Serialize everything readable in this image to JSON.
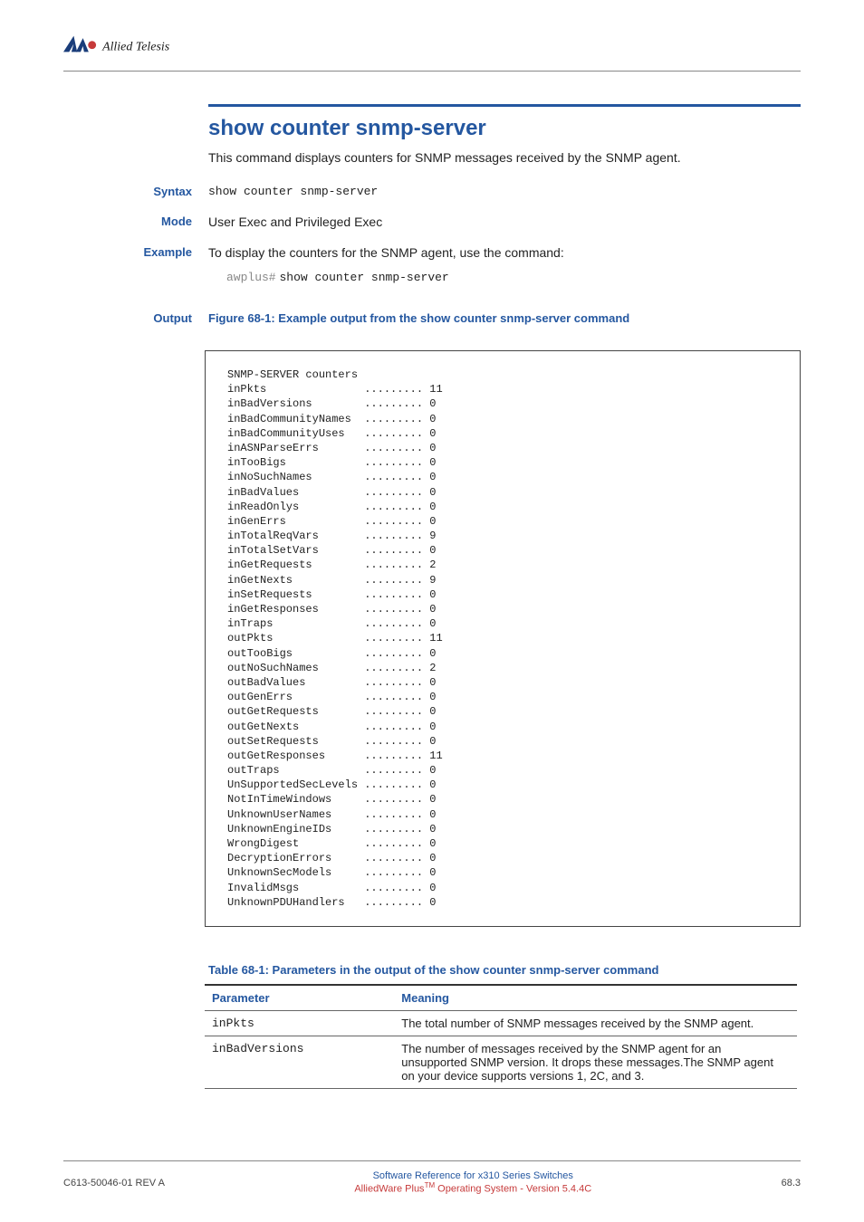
{
  "brand": "Allied Telesis",
  "title": "show counter snmp-server",
  "intro": "This command displays counters for SNMP messages received by the SNMP agent.",
  "sections": {
    "syntax": {
      "label": "Syntax",
      "text": "show counter snmp-server"
    },
    "mode": {
      "label": "Mode",
      "text": "User Exec and Privileged Exec"
    },
    "example": {
      "label": "Example",
      "text": "To display the counters for the SNMP agent, use the command:",
      "prompt": "awplus#",
      "cmd": "show counter snmp-server"
    },
    "output": {
      "label": "Output",
      "caption": "Figure 68-1: Example output from the show counter snmp-server command"
    }
  },
  "output_header": "SNMP-SERVER counters",
  "counters": [
    {
      "name": "inPkts",
      "value": "11"
    },
    {
      "name": "inBadVersions",
      "value": "0"
    },
    {
      "name": "inBadCommunityNames",
      "value": "0"
    },
    {
      "name": "inBadCommunityUses",
      "value": "0"
    },
    {
      "name": "inASNParseErrs",
      "value": "0"
    },
    {
      "name": "inTooBigs",
      "value": "0"
    },
    {
      "name": "inNoSuchNames",
      "value": "0"
    },
    {
      "name": "inBadValues",
      "value": "0"
    },
    {
      "name": "inReadOnlys",
      "value": "0"
    },
    {
      "name": "inGenErrs",
      "value": "0"
    },
    {
      "name": "inTotalReqVars",
      "value": "9"
    },
    {
      "name": "inTotalSetVars",
      "value": "0"
    },
    {
      "name": "inGetRequests",
      "value": "2"
    },
    {
      "name": "inGetNexts",
      "value": "9"
    },
    {
      "name": "inSetRequests",
      "value": "0"
    },
    {
      "name": "inGetResponses",
      "value": "0"
    },
    {
      "name": "inTraps",
      "value": "0"
    },
    {
      "name": "outPkts",
      "value": "11"
    },
    {
      "name": "outTooBigs",
      "value": "0"
    },
    {
      "name": "outNoSuchNames",
      "value": "2"
    },
    {
      "name": "outBadValues",
      "value": "0"
    },
    {
      "name": "outGenErrs",
      "value": "0"
    },
    {
      "name": "outGetRequests",
      "value": "0"
    },
    {
      "name": "outGetNexts",
      "value": "0"
    },
    {
      "name": "outSetRequests",
      "value": "0"
    },
    {
      "name": "outGetResponses",
      "value": "11"
    },
    {
      "name": "outTraps",
      "value": "0"
    },
    {
      "name": "UnSupportedSecLevels",
      "value": "0"
    },
    {
      "name": "NotInTimeWindows",
      "value": "0"
    },
    {
      "name": "UnknownUserNames",
      "value": "0"
    },
    {
      "name": "UnknownEngineIDs",
      "value": "0"
    },
    {
      "name": "WrongDigest",
      "value": "0"
    },
    {
      "name": "DecryptionErrors",
      "value": "0"
    },
    {
      "name": "UnknownSecModels",
      "value": "0"
    },
    {
      "name": "InvalidMsgs",
      "value": "0"
    },
    {
      "name": "UnknownPDUHandlers",
      "value": "0"
    }
  ],
  "table": {
    "caption": "Table 68-1: Parameters in the output of the show counter snmp-server command",
    "header_param": "Parameter",
    "header_meaning": "Meaning",
    "rows": [
      {
        "param": "inPkts",
        "meaning": "The total number of SNMP messages received by the SNMP agent."
      },
      {
        "param": "inBadVersions",
        "meaning": "The number of messages received by the SNMP agent for an unsupported SNMP version. It drops these messages.The SNMP agent on your device supports versions 1, 2C, and 3."
      }
    ]
  },
  "footer": {
    "left": "C613-50046-01 REV A",
    "center1": "Software Reference for x310 Series Switches",
    "center2a": "AlliedWare Plus",
    "center2b": " Operating System - Version 5.4.4C",
    "right": "68.3"
  }
}
